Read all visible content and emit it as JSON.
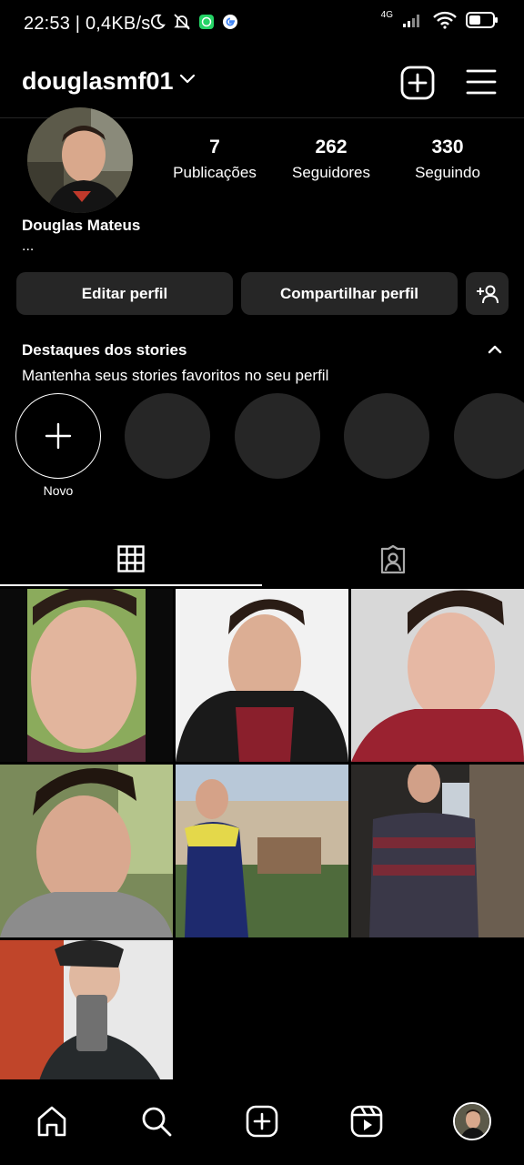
{
  "status_bar": {
    "time_speed": "22:53 | 0,4KB/s",
    "network": "4G"
  },
  "header": {
    "username": "douglasmf01"
  },
  "profile": {
    "full_name": "Douglas Mateus",
    "bio": "...",
    "stats": [
      {
        "value": "7",
        "label": "Publicações"
      },
      {
        "value": "262",
        "label": "Seguidores"
      },
      {
        "value": "330",
        "label": "Seguindo"
      }
    ]
  },
  "actions": {
    "edit_label": "Editar perfil",
    "share_label": "Compartilhar perfil"
  },
  "highlights": {
    "title": "Destaques dos stories",
    "subtitle": "Mantenha seus stories favoritos no seu perfil",
    "new_label": "Novo"
  },
  "colors": {
    "background": "#000000",
    "button": "#262626",
    "placeholder": "#262626",
    "text": "#ffffff"
  }
}
